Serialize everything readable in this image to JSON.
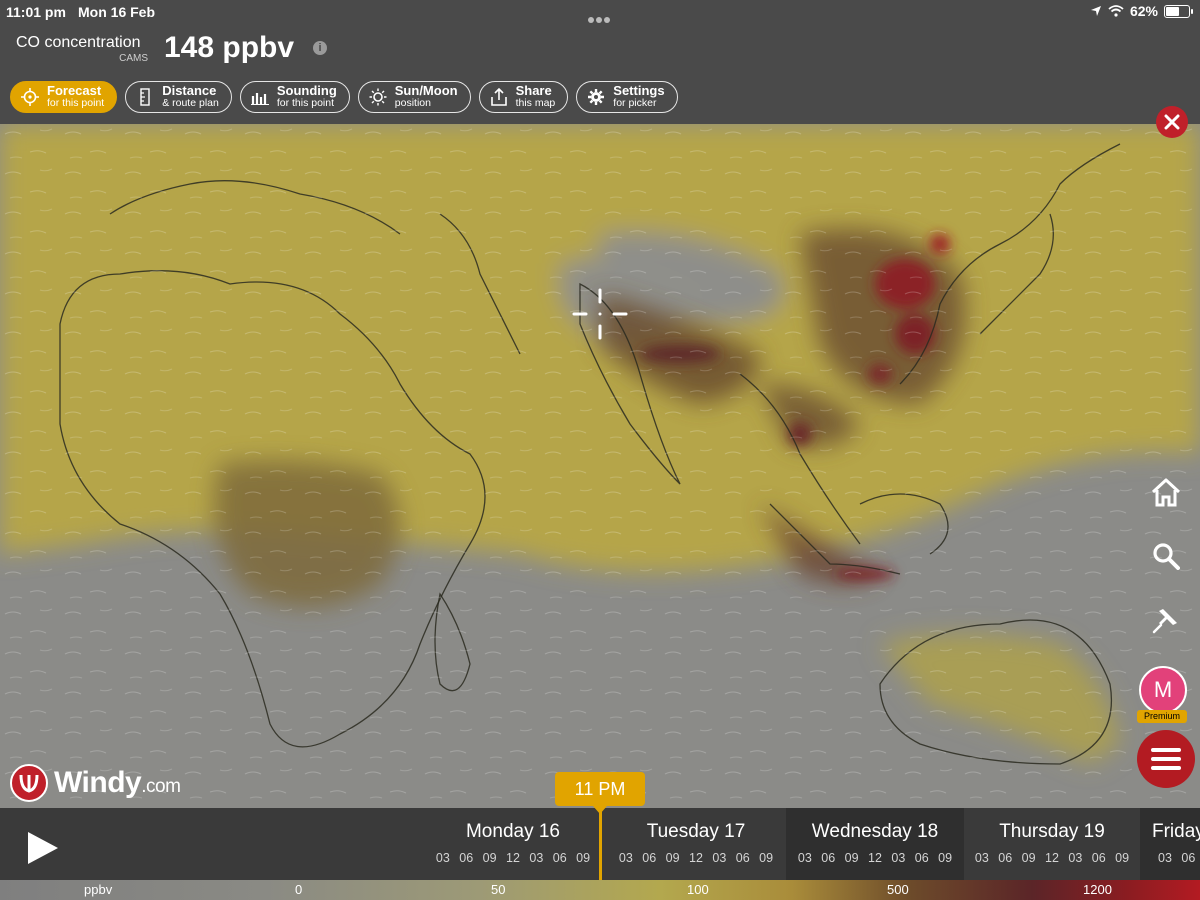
{
  "status_bar": {
    "time": "11:01 pm",
    "date": "Mon 16 Feb",
    "battery": "62%",
    "battery_level": 0.62
  },
  "header": {
    "layer_name": "CO concentration",
    "layer_source": "CAMS",
    "value": "148 ppbv",
    "info_icon": "i"
  },
  "toolbar": [
    {
      "line1": "Forecast",
      "line2": "for this point",
      "icon": "crosshair-icon",
      "active": true
    },
    {
      "line1": "Distance",
      "line2": "& route plan",
      "icon": "ruler-icon",
      "active": false
    },
    {
      "line1": "Sounding",
      "line2": "for this point",
      "icon": "sounding-chart-icon",
      "active": false
    },
    {
      "line1": "Sun/Moon",
      "line2": "position",
      "icon": "sun-icon",
      "active": false
    },
    {
      "line1": "Share",
      "line2": "this map",
      "icon": "share-icon",
      "active": false
    },
    {
      "line1": "Settings",
      "line2": "for picker",
      "icon": "gear-icon",
      "active": false
    }
  ],
  "side": {
    "avatar_letter": "M",
    "premium_label": "Premium"
  },
  "logo": {
    "name": "Windy",
    "suffix": ".com"
  },
  "timeline": {
    "current_time": "11 PM",
    "days": [
      {
        "name": "Monday 16",
        "hours": "03 06 09 12 03 06 09"
      },
      {
        "name": "Tuesday 17",
        "hours": "03 06 09 12 03 06 09"
      },
      {
        "name": "Wednesday 18",
        "hours": "03 06 09 12 03 06 09"
      },
      {
        "name": "Thursday 19",
        "hours": "03 06 09 12 03 06 09"
      },
      {
        "name": "Friday",
        "hours": "03 06"
      }
    ]
  },
  "legend": {
    "unit": "ppbv",
    "stops": [
      "0",
      "50",
      "100",
      "500",
      "1200"
    ]
  },
  "colors": {
    "accent": "#e1a400",
    "danger": "#c0202a",
    "panel": "#4a4a4a"
  }
}
